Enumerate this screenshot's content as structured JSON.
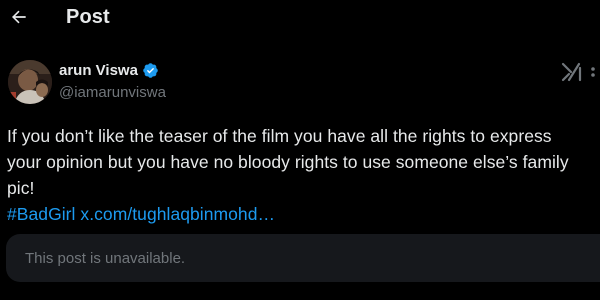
{
  "header": {
    "back_icon": "arrow-left-icon",
    "title": "Post"
  },
  "author": {
    "name": "arun Viswa",
    "handle": "@iamarunviswa",
    "verified": true,
    "verified_color": "#1d9bf0"
  },
  "post": {
    "lines": [
      "If you don’t like the teaser of the film you have all the rights to express",
      "your opinion but you have no bloody rights to use someone else’s family",
      "pic!"
    ],
    "hashtag": "#BadGirl",
    "link": "x.com/tughlaqbinmohd…"
  },
  "quoted": {
    "message": "This post is unavailable."
  },
  "colors": {
    "background": "#000000",
    "text": "#e7e9ea",
    "secondary": "#71767b",
    "accent": "#1d9bf0",
    "card": "#16181c"
  },
  "icons": {
    "grok": "grok-icon",
    "more": "more-options-icon"
  }
}
